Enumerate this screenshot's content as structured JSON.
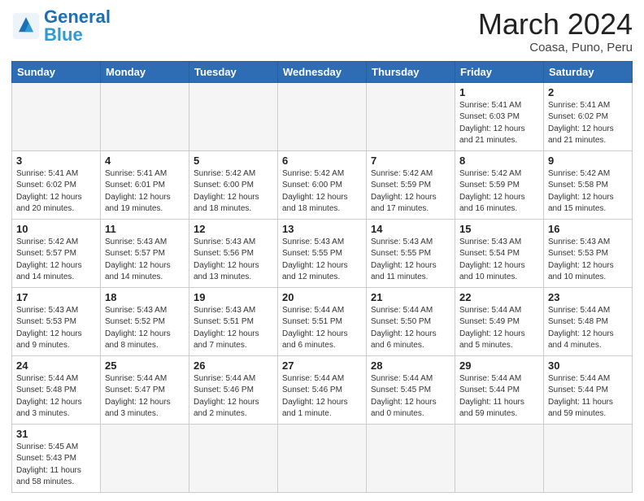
{
  "header": {
    "logo_general": "General",
    "logo_blue": "Blue",
    "month_title": "March 2024",
    "location": "Coasa, Puno, Peru"
  },
  "days_of_week": [
    "Sunday",
    "Monday",
    "Tuesday",
    "Wednesday",
    "Thursday",
    "Friday",
    "Saturday"
  ],
  "weeks": [
    [
      {
        "day": "",
        "info": ""
      },
      {
        "day": "",
        "info": ""
      },
      {
        "day": "",
        "info": ""
      },
      {
        "day": "",
        "info": ""
      },
      {
        "day": "",
        "info": ""
      },
      {
        "day": "1",
        "info": "Sunrise: 5:41 AM\nSunset: 6:03 PM\nDaylight: 12 hours and 21 minutes."
      },
      {
        "day": "2",
        "info": "Sunrise: 5:41 AM\nSunset: 6:02 PM\nDaylight: 12 hours and 21 minutes."
      }
    ],
    [
      {
        "day": "3",
        "info": "Sunrise: 5:41 AM\nSunset: 6:02 PM\nDaylight: 12 hours and 20 minutes."
      },
      {
        "day": "4",
        "info": "Sunrise: 5:41 AM\nSunset: 6:01 PM\nDaylight: 12 hours and 19 minutes."
      },
      {
        "day": "5",
        "info": "Sunrise: 5:42 AM\nSunset: 6:00 PM\nDaylight: 12 hours and 18 minutes."
      },
      {
        "day": "6",
        "info": "Sunrise: 5:42 AM\nSunset: 6:00 PM\nDaylight: 12 hours and 18 minutes."
      },
      {
        "day": "7",
        "info": "Sunrise: 5:42 AM\nSunset: 5:59 PM\nDaylight: 12 hours and 17 minutes."
      },
      {
        "day": "8",
        "info": "Sunrise: 5:42 AM\nSunset: 5:59 PM\nDaylight: 12 hours and 16 minutes."
      },
      {
        "day": "9",
        "info": "Sunrise: 5:42 AM\nSunset: 5:58 PM\nDaylight: 12 hours and 15 minutes."
      }
    ],
    [
      {
        "day": "10",
        "info": "Sunrise: 5:42 AM\nSunset: 5:57 PM\nDaylight: 12 hours and 14 minutes."
      },
      {
        "day": "11",
        "info": "Sunrise: 5:43 AM\nSunset: 5:57 PM\nDaylight: 12 hours and 14 minutes."
      },
      {
        "day": "12",
        "info": "Sunrise: 5:43 AM\nSunset: 5:56 PM\nDaylight: 12 hours and 13 minutes."
      },
      {
        "day": "13",
        "info": "Sunrise: 5:43 AM\nSunset: 5:55 PM\nDaylight: 12 hours and 12 minutes."
      },
      {
        "day": "14",
        "info": "Sunrise: 5:43 AM\nSunset: 5:55 PM\nDaylight: 12 hours and 11 minutes."
      },
      {
        "day": "15",
        "info": "Sunrise: 5:43 AM\nSunset: 5:54 PM\nDaylight: 12 hours and 10 minutes."
      },
      {
        "day": "16",
        "info": "Sunrise: 5:43 AM\nSunset: 5:53 PM\nDaylight: 12 hours and 10 minutes."
      }
    ],
    [
      {
        "day": "17",
        "info": "Sunrise: 5:43 AM\nSunset: 5:53 PM\nDaylight: 12 hours and 9 minutes."
      },
      {
        "day": "18",
        "info": "Sunrise: 5:43 AM\nSunset: 5:52 PM\nDaylight: 12 hours and 8 minutes."
      },
      {
        "day": "19",
        "info": "Sunrise: 5:43 AM\nSunset: 5:51 PM\nDaylight: 12 hours and 7 minutes."
      },
      {
        "day": "20",
        "info": "Sunrise: 5:44 AM\nSunset: 5:51 PM\nDaylight: 12 hours and 6 minutes."
      },
      {
        "day": "21",
        "info": "Sunrise: 5:44 AM\nSunset: 5:50 PM\nDaylight: 12 hours and 6 minutes."
      },
      {
        "day": "22",
        "info": "Sunrise: 5:44 AM\nSunset: 5:49 PM\nDaylight: 12 hours and 5 minutes."
      },
      {
        "day": "23",
        "info": "Sunrise: 5:44 AM\nSunset: 5:48 PM\nDaylight: 12 hours and 4 minutes."
      }
    ],
    [
      {
        "day": "24",
        "info": "Sunrise: 5:44 AM\nSunset: 5:48 PM\nDaylight: 12 hours and 3 minutes."
      },
      {
        "day": "25",
        "info": "Sunrise: 5:44 AM\nSunset: 5:47 PM\nDaylight: 12 hours and 3 minutes."
      },
      {
        "day": "26",
        "info": "Sunrise: 5:44 AM\nSunset: 5:46 PM\nDaylight: 12 hours and 2 minutes."
      },
      {
        "day": "27",
        "info": "Sunrise: 5:44 AM\nSunset: 5:46 PM\nDaylight: 12 hours and 1 minute."
      },
      {
        "day": "28",
        "info": "Sunrise: 5:44 AM\nSunset: 5:45 PM\nDaylight: 12 hours and 0 minutes."
      },
      {
        "day": "29",
        "info": "Sunrise: 5:44 AM\nSunset: 5:44 PM\nDaylight: 11 hours and 59 minutes."
      },
      {
        "day": "30",
        "info": "Sunrise: 5:44 AM\nSunset: 5:44 PM\nDaylight: 11 hours and 59 minutes."
      }
    ],
    [
      {
        "day": "31",
        "info": "Sunrise: 5:45 AM\nSunset: 5:43 PM\nDaylight: 11 hours and 58 minutes."
      },
      {
        "day": "",
        "info": ""
      },
      {
        "day": "",
        "info": ""
      },
      {
        "day": "",
        "info": ""
      },
      {
        "day": "",
        "info": ""
      },
      {
        "day": "",
        "info": ""
      },
      {
        "day": "",
        "info": ""
      }
    ]
  ]
}
